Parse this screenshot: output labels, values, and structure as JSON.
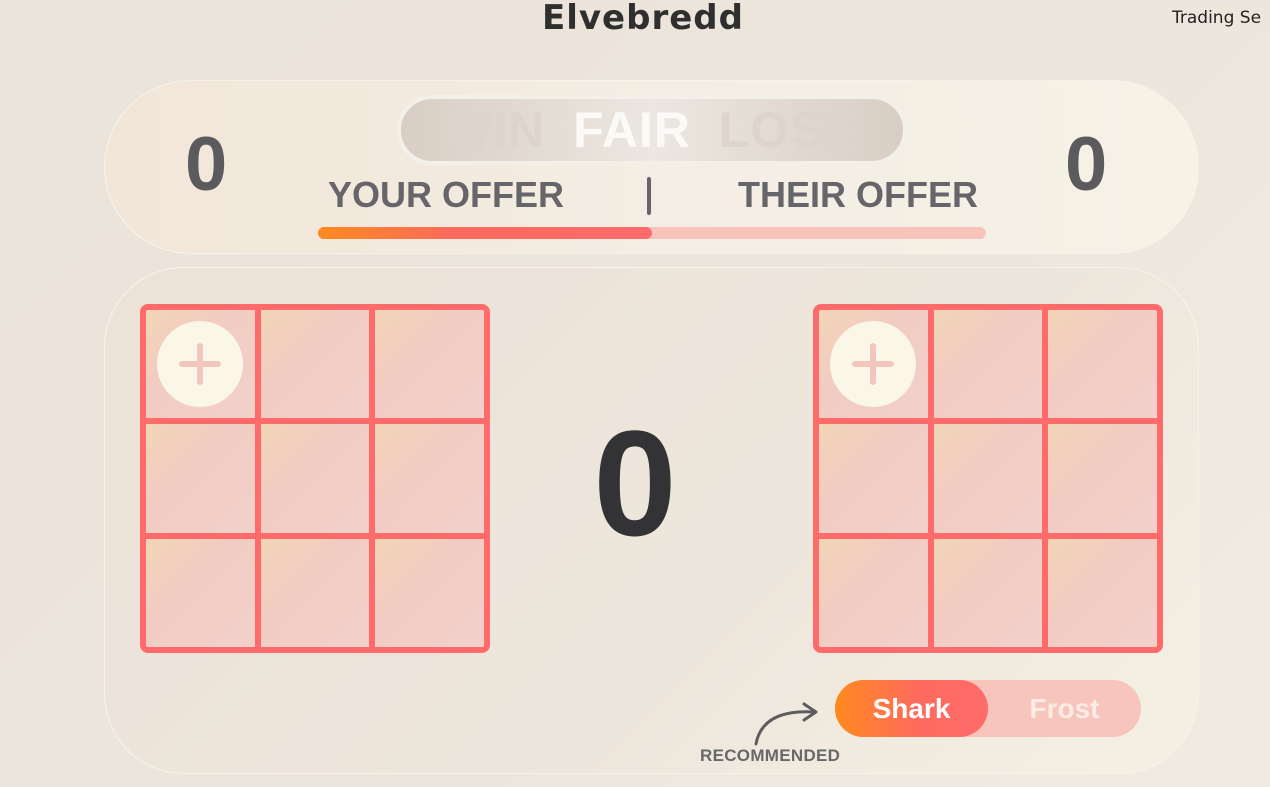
{
  "header": {
    "logo": "Elvebredd",
    "nav_link": "Trading Se"
  },
  "scoreboard": {
    "your_value": "0",
    "their_value": "0",
    "verdicts": [
      "WIN",
      "FAIR",
      "LOSE"
    ],
    "active_verdict": "FAIR",
    "your_offer_label": "YOUR OFFER",
    "divider": "|",
    "their_offer_label": "THEIR OFFER",
    "balance_fraction": 0.5
  },
  "trade": {
    "difference": "0",
    "your_slots": 9,
    "their_slots": 9
  },
  "mode": {
    "options": [
      "Shark",
      "Frost"
    ],
    "selected": "Shark",
    "recommended_label": "RECOMMENDED"
  },
  "colors": {
    "accent": "#ff6b6b",
    "accent_orange": "#ff8a1e",
    "text_gray": "#5b5b5e"
  }
}
